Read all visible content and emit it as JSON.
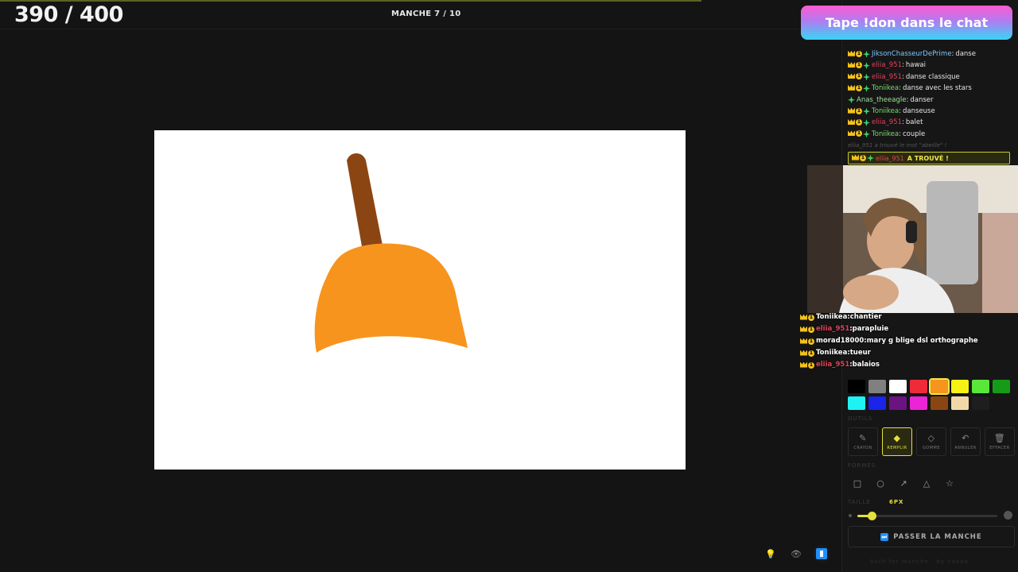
{
  "header": {
    "score": "390 / 400",
    "round": "MANCHE 7 / 10"
  },
  "banner": "Tape !don dans le chat",
  "chat": [
    {
      "user": "JiksonChasseurDePrime",
      "text": "danse",
      "badges": [
        "crown",
        "one",
        "star"
      ],
      "ucls": "u1"
    },
    {
      "user": "eliia_951",
      "text": "hawai",
      "badges": [
        "crown",
        "one",
        "star"
      ],
      "ucls": "u2"
    },
    {
      "user": "eliia_951",
      "text": "danse classique",
      "badges": [
        "crown",
        "one",
        "star"
      ],
      "ucls": "u2"
    },
    {
      "user": "Toniikea",
      "text": "danse avec les stars",
      "badges": [
        "crown",
        "one",
        "star"
      ],
      "ucls": "u3"
    },
    {
      "user": "Anas_theeagle",
      "text": "danser",
      "badges": [
        "star"
      ],
      "ucls": "u4"
    },
    {
      "user": "Toniikea",
      "text": "danseuse",
      "badges": [
        "crown",
        "one",
        "star"
      ],
      "ucls": "u3"
    },
    {
      "user": "eliia_951",
      "text": "balet",
      "badges": [
        "crown",
        "one",
        "star"
      ],
      "ucls": "u2"
    },
    {
      "user": "Toniikea",
      "text": "couple",
      "badges": [
        "crown",
        "one",
        "star"
      ],
      "ucls": "u3"
    }
  ],
  "chat_faint": "eliia_951 a trouvé le mot \"abeille\" !",
  "found": {
    "user": "eliia_951",
    "text": "A TROUVÉ !"
  },
  "overlay_chat": [
    {
      "user": "Toniikea",
      "text": "chantier",
      "red": false
    },
    {
      "user": "eliia_951",
      "text": "parapluie",
      "red": true
    },
    {
      "user": "morad18000",
      "text": "mary g blige dsl orthographe",
      "red": false
    },
    {
      "user": "Toniikea",
      "text": "tueur",
      "red": false
    },
    {
      "user": "eliia_951",
      "text": "balaios",
      "red": true
    }
  ],
  "palette": {
    "row1": [
      "#000000",
      "#808080",
      "#ffffff",
      "#ef2b3a",
      "#f7941d",
      "#f5f214",
      "#58e83a",
      "#159b17"
    ],
    "row2": [
      "#1ef2f2",
      "#1a24ea",
      "#6b1381",
      "#ec23d6",
      "#8b4513",
      "#f2d8a8",
      "#1e1e1e"
    ],
    "selected": "#f7941d"
  },
  "labels": {
    "outils": "OUTILS",
    "formes": "FORMES",
    "taille": "TAILLE",
    "size_value": "6PX"
  },
  "tools": [
    {
      "name": "crayon",
      "label": "CRAYON",
      "icon": "✎",
      "active": false
    },
    {
      "name": "remplir",
      "label": "REMPLIR",
      "icon": "◆",
      "active": true
    },
    {
      "name": "gomme",
      "label": "GOMME",
      "icon": "◇",
      "active": false
    },
    {
      "name": "annuler",
      "label": "ANNULER",
      "icon": "↶",
      "active": false
    },
    {
      "name": "effacer",
      "label": "EFFACER",
      "icon": "🗑",
      "active": false
    }
  ],
  "shapes": [
    {
      "name": "rectangle",
      "icon": "□"
    },
    {
      "name": "ellipse",
      "icon": "○"
    },
    {
      "name": "arrow",
      "icon": "↗"
    },
    {
      "name": "triangle",
      "icon": "△"
    },
    {
      "name": "star",
      "icon": "☆"
    }
  ],
  "size_fraction": 0.1,
  "pass_button": "PASSER LA MANCHE",
  "footer": "built for manche · by xaddo",
  "drawing": {
    "handle_color": "#8b4513",
    "body_color": "#f7941d"
  }
}
